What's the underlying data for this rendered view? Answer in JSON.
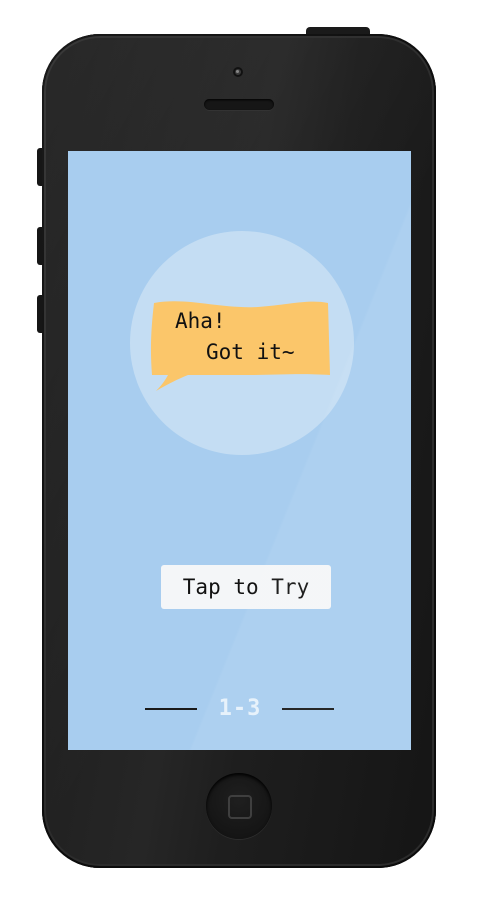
{
  "bubble": {
    "line1": "Aha!",
    "line2": "Got it~"
  },
  "tap_button": {
    "label": "Tap to Try"
  },
  "level": {
    "label": "1-3"
  },
  "colors": {
    "screen_background": "#a8cdef",
    "circle": "#c4ddf3",
    "bubble": "#fbc66a",
    "button_background": "#f4f6f8",
    "phone_body": "#1e1e1e"
  },
  "icons": {
    "home": "home-button-icon",
    "camera": "camera-icon",
    "speaker": "earpiece-speaker"
  }
}
